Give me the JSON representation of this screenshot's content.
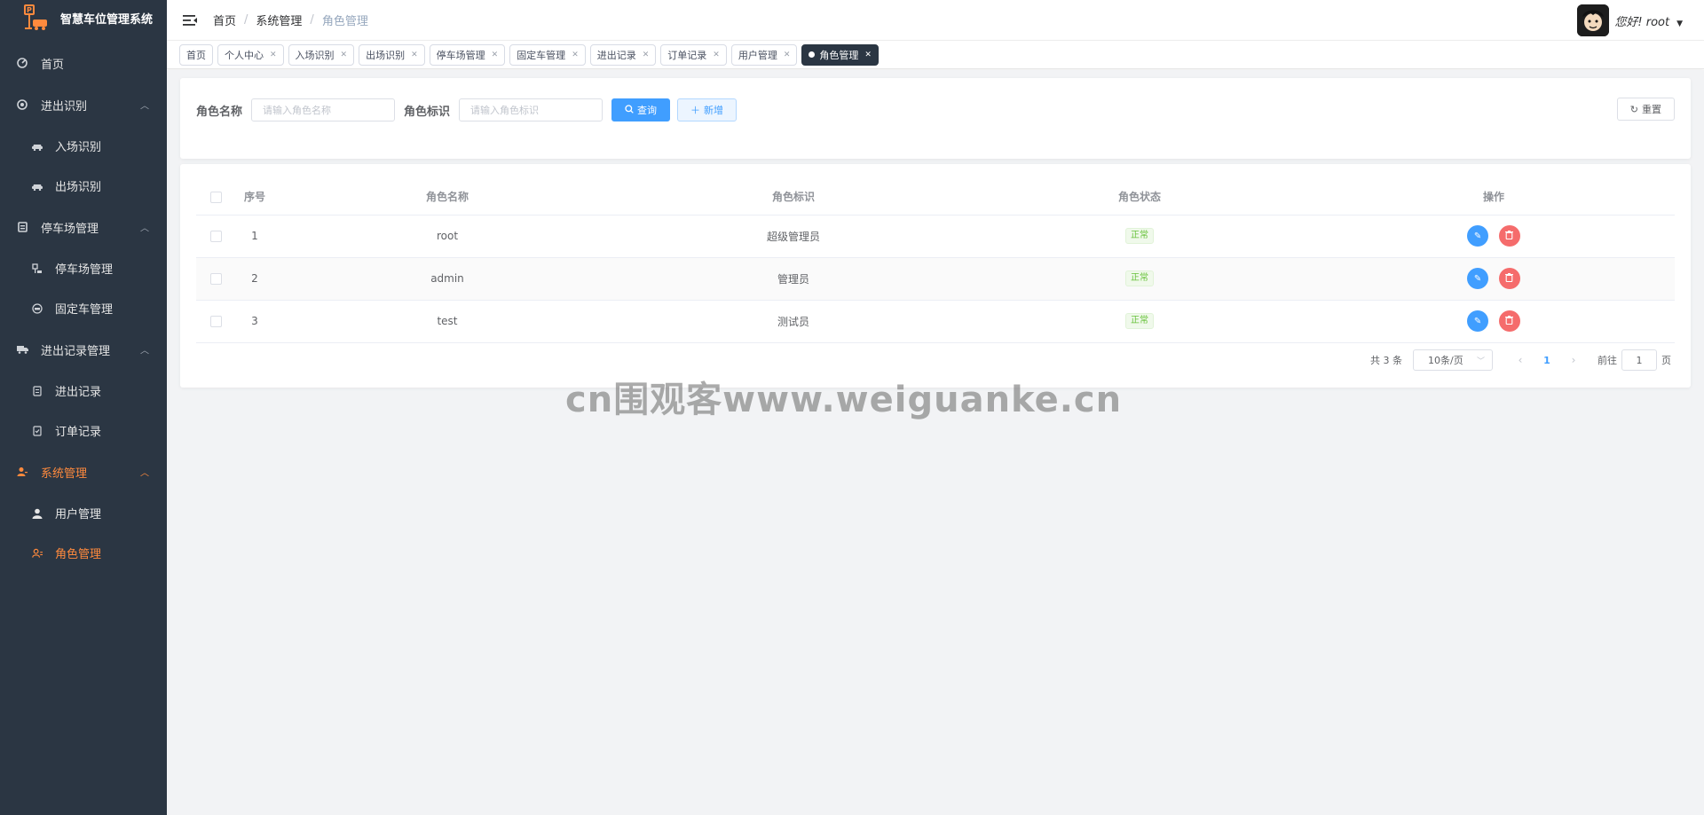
{
  "app": {
    "title": "智慧车位管理系统"
  },
  "sidebar": {
    "items": [
      {
        "label": "首页",
        "icon": "dashboard-icon",
        "type": "item"
      },
      {
        "label": "进出识别",
        "icon": "scan-icon",
        "type": "group"
      },
      {
        "label": "入场识别",
        "icon": "car-icon",
        "type": "sub"
      },
      {
        "label": "出场识别",
        "icon": "car-icon",
        "type": "sub"
      },
      {
        "label": "停车场管理",
        "icon": "document-icon",
        "type": "group"
      },
      {
        "label": "停车场管理",
        "icon": "parking-icon",
        "type": "sub"
      },
      {
        "label": "固定车管理",
        "icon": "fixed-car-icon",
        "type": "sub"
      },
      {
        "label": "进出记录管理",
        "icon": "truck-icon",
        "type": "group"
      },
      {
        "label": "进出记录",
        "icon": "record-icon",
        "type": "sub"
      },
      {
        "label": "订单记录",
        "icon": "order-icon",
        "type": "sub"
      },
      {
        "label": "系统管理",
        "icon": "system-icon",
        "type": "group",
        "active": true
      },
      {
        "label": "用户管理",
        "icon": "user-icon",
        "type": "sub"
      },
      {
        "label": "角色管理",
        "icon": "role-icon",
        "type": "sub",
        "active": true
      }
    ],
    "active_color": "#ff8a3d"
  },
  "header": {
    "breadcrumb": [
      "首页",
      "系统管理",
      "角色管理"
    ],
    "greeting": "您好! root"
  },
  "tags": [
    {
      "label": "首页",
      "closable": false
    },
    {
      "label": "个人中心",
      "closable": true
    },
    {
      "label": "入场识别",
      "closable": true
    },
    {
      "label": "出场识别",
      "closable": true
    },
    {
      "label": "停车场管理",
      "closable": true
    },
    {
      "label": "固定车管理",
      "closable": true
    },
    {
      "label": "进出记录",
      "closable": true
    },
    {
      "label": "订单记录",
      "closable": true
    },
    {
      "label": "用户管理",
      "closable": true
    },
    {
      "label": "角色管理",
      "closable": true,
      "active": true
    }
  ],
  "search": {
    "role_name_label": "角色名称",
    "role_name_placeholder": "请输入角色名称",
    "role_key_label": "角色标识",
    "role_key_placeholder": "请输入角色标识",
    "query_label": "查询",
    "add_label": "新增",
    "reset_label": "重置"
  },
  "table": {
    "columns": [
      "序号",
      "角色名称",
      "角色标识",
      "角色状态",
      "操作"
    ],
    "rows": [
      {
        "index": "1",
        "name": "root",
        "key": "超级管理员",
        "status": "正常"
      },
      {
        "index": "2",
        "name": "admin",
        "key": "管理员",
        "status": "正常"
      },
      {
        "index": "3",
        "name": "test",
        "key": "测试员",
        "status": "正常"
      }
    ]
  },
  "pagination": {
    "total": "共 3 条",
    "page_size": "10条/页",
    "current_page": "1",
    "goto_label": "前往",
    "goto_value": "1",
    "page_suffix": "页"
  },
  "watermark": "cn围观客www.weiguanke.cn",
  "colors": {
    "sidebar_bg": "#2b3643",
    "primary": "#409eff",
    "danger": "#f56c6c",
    "success": "#67c23a"
  }
}
